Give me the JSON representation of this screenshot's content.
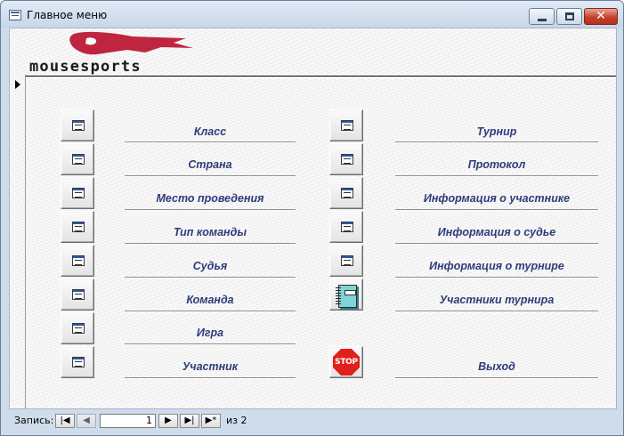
{
  "window": {
    "title": "Главное меню",
    "min_icon": "minimize-icon",
    "max_icon": "maximize-icon",
    "close_glyph": "✕"
  },
  "logo": {
    "text": "mousesports",
    "color": "#c0253f"
  },
  "menu_left": [
    {
      "label": "Класс"
    },
    {
      "label": "Страна"
    },
    {
      "label": "Место проведения"
    },
    {
      "label": "Тип команды"
    },
    {
      "label": "Судья"
    },
    {
      "label": "Команда"
    },
    {
      "label": "Игра"
    },
    {
      "label": "Участник"
    }
  ],
  "menu_right": [
    {
      "label": "Турнир",
      "icon": "form-icon"
    },
    {
      "label": "Протокол",
      "icon": "form-icon"
    },
    {
      "label": "Информация о участнике",
      "icon": "form-icon"
    },
    {
      "label": "Информация о судье",
      "icon": "form-icon"
    },
    {
      "label": "Информация о турнире",
      "icon": "form-icon"
    },
    {
      "label": "Участники турнира",
      "icon": "notebook-icon"
    }
  ],
  "exit": {
    "label": "Выход",
    "icon_text": "STOP"
  },
  "navigation": {
    "record_label": "Запись:",
    "current": "1",
    "of_label": "из",
    "total": "2",
    "first_glyph": "|◀",
    "prev_glyph": "◀",
    "next_glyph": "▶",
    "last_glyph": "▶|",
    "new_glyph": "▶*"
  },
  "colors": {
    "label_text": "#2e3c7a",
    "stop_red": "#e0201c"
  }
}
